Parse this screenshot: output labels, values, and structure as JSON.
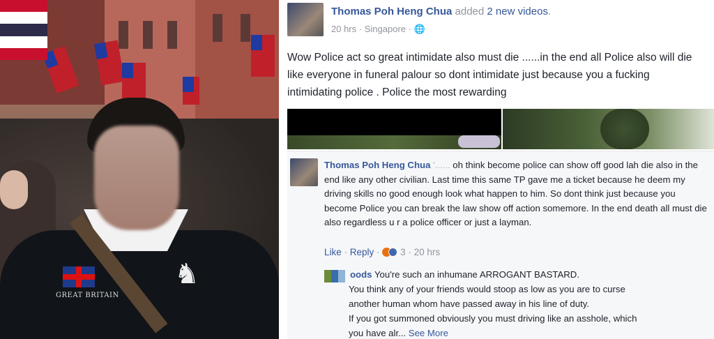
{
  "post": {
    "author": "Thomas Poh Heng Chua",
    "action": "added",
    "action_link": "2 new videos",
    "action_end": ".",
    "time": "20 hrs",
    "separator": "·",
    "location": "Singapore",
    "privacy_icon": "globe-icon",
    "body_text": "Wow Police act so great intimidate also must die ......in the end all Police also will die like everyone in funeral palour so dont intimidate just because you a fucking intimidating police . Police the most rewarding"
  },
  "comment": {
    "author": "Thomas Poh Heng Chua",
    "redacted": "'...... ",
    "text": "oh think become police can show off good lah die also in the end like any other civilian. Last time this same TP gave me a ticket because he deem my driving skills no good enough look what happen to him. So dont think just because you become Police you can break the law show off action somemore. In the end death all must die also regardless u r a police officer or just a layman.",
    "like_label": "Like",
    "reply_label": "Reply",
    "reaction_count": "3",
    "time": "20 hrs"
  },
  "reply": {
    "author_fragment": "oods",
    "line1": "You're such an inhumane ARROGANT BASTARD.",
    "line2": "You think any of your friends would stoop as low as you are to curse",
    "line3": "another human whom have passed away in his line of duty.",
    "line4": "If you got summoned obviously you must driving like an asshole, which",
    "line5_start": "you have alr...",
    "see_more": "See More"
  },
  "photo": {
    "shirt_text": "GREAT BRITAIN"
  },
  "colors": {
    "link_blue": "#365899",
    "meta_grey": "#90949c",
    "comment_bg": "#f6f7f9"
  }
}
